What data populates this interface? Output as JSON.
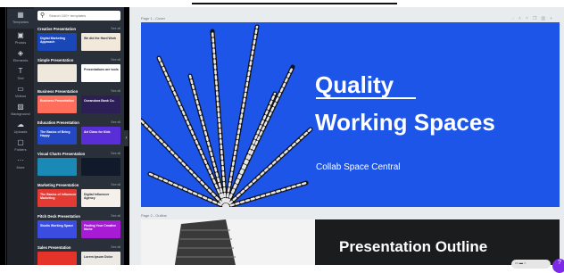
{
  "rail": {
    "items": [
      {
        "label": "Templates",
        "icon": "template-icon"
      },
      {
        "label": "Photos",
        "icon": "image-icon"
      },
      {
        "label": "Elements",
        "icon": "shapes-icon"
      },
      {
        "label": "Text",
        "icon": "text-icon"
      },
      {
        "label": "Videos",
        "icon": "video-icon"
      },
      {
        "label": "Background",
        "icon": "background-icon"
      },
      {
        "label": "Uploads",
        "icon": "upload-icon"
      },
      {
        "label": "Folders",
        "icon": "folder-icon"
      },
      {
        "label": "More",
        "icon": "more-icon"
      }
    ]
  },
  "search": {
    "placeholder": "Search 100+ templates"
  },
  "sections": [
    {
      "title": "Creative Presentation",
      "see_all": "See all",
      "thumbs": [
        "Digital Marketing Approach",
        "We did the Hard Work"
      ],
      "colors": [
        "#1a47b8",
        "#f2e9dc"
      ]
    },
    {
      "title": "Simple Presentation",
      "see_all": "See all",
      "thumbs": [
        "",
        "Presentations are tools"
      ],
      "colors": [
        "#efe8dd",
        "#ffffff"
      ]
    },
    {
      "title": "Business Presentation",
      "see_all": "See all",
      "thumbs": [
        "Business Presentation",
        "Oceandora Bank Co."
      ],
      "colors": [
        "#ff6e5a",
        "#2b1f55"
      ]
    },
    {
      "title": "Education Presentation",
      "see_all": "See all",
      "thumbs": [
        "The Basics of Being Happy",
        "Art Class for Kids"
      ],
      "colors": [
        "#2447c4",
        "#5a2ed6"
      ]
    },
    {
      "title": "Visual Charts Presentation",
      "see_all": "See all",
      "thumbs": [
        "",
        ""
      ],
      "colors": [
        "#1b89b6",
        "#101a2b"
      ]
    },
    {
      "title": "Marketing Presentation",
      "see_all": "See all",
      "thumbs": [
        "The Basics of Influencer Marketing",
        "Digital Influencer Agency"
      ],
      "colors": [
        "#e33b34",
        "#f5f0ea"
      ]
    },
    {
      "title": "Pitch Deck Presentation",
      "see_all": "See all",
      "thumbs": [
        "Studio Working Space",
        "Finding Your Creative Niche"
      ],
      "colors": [
        "#3a4de0",
        "#a81bd5"
      ]
    },
    {
      "title": "Sales Presentation",
      "see_all": "See all",
      "thumbs": [
        "",
        "Lorem Ipsum Dolor"
      ],
      "colors": [
        "#e5332a",
        "#ece9e4"
      ]
    }
  ],
  "canvas": {
    "page1_label": "Page 1 - Cover",
    "page2_label": "Page 2 - Outline",
    "slide1": {
      "title_line1": "Quality",
      "title_line2": "Working Spaces",
      "subtitle": "Collab Space Central",
      "color": "#1d55e8"
    },
    "slide2": {
      "title": "Presentation Outline"
    }
  },
  "help": {
    "label": "?"
  }
}
